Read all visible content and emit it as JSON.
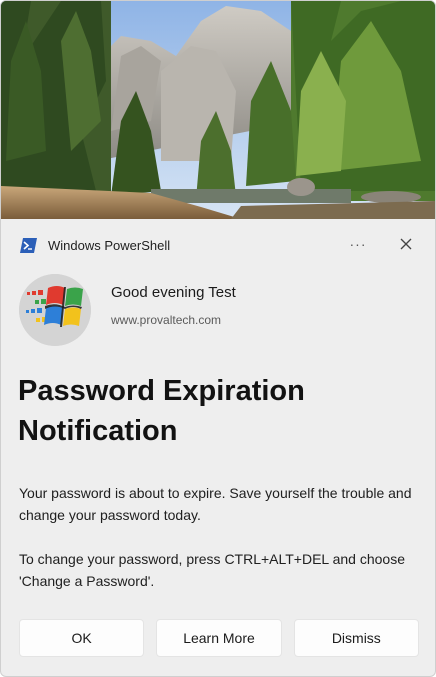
{
  "header": {
    "app_name": "Windows PowerShell",
    "more_label": "···"
  },
  "sender": {
    "greeting": "Good evening Test",
    "website": "www.provaltech.com"
  },
  "notification": {
    "title": "Password Expiration Notification",
    "paragraphs": [
      "Your password is about to expire. Save yourself the trouble and change your password today.",
      "To change your password, press CTRL+ALT+DEL and choose 'Change a Password'."
    ]
  },
  "buttons": {
    "ok": "OK",
    "learn_more": "Learn More",
    "dismiss": "Dismiss"
  },
  "colors": {
    "powershell_icon": "#2b5fb8",
    "toast_background": "#eeeeee",
    "button_background": "#fdfdfd"
  }
}
